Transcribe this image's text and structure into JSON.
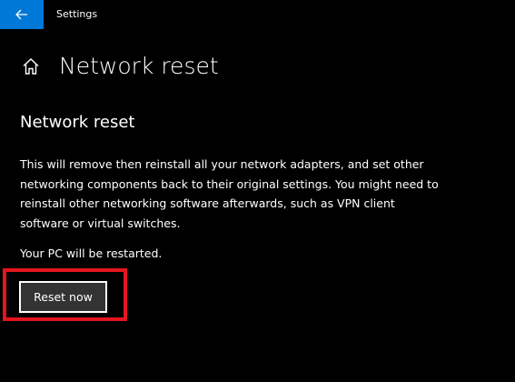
{
  "window": {
    "title": "Settings",
    "accent_color": "#0078d7",
    "back_icon": "arrow-left-icon"
  },
  "header": {
    "home_icon": "home-icon",
    "title": "Network reset"
  },
  "section": {
    "heading": "Network reset",
    "description": "This will remove then reinstall all your network adapters, and set other networking components back to their original settings. You might need to reinstall other networking software afterwards, such as VPN client software or virtual switches.",
    "restart_note": "Your PC will be restarted.",
    "reset_button_label": "Reset now"
  },
  "annotation": {
    "highlight_color": "#e3151d"
  }
}
